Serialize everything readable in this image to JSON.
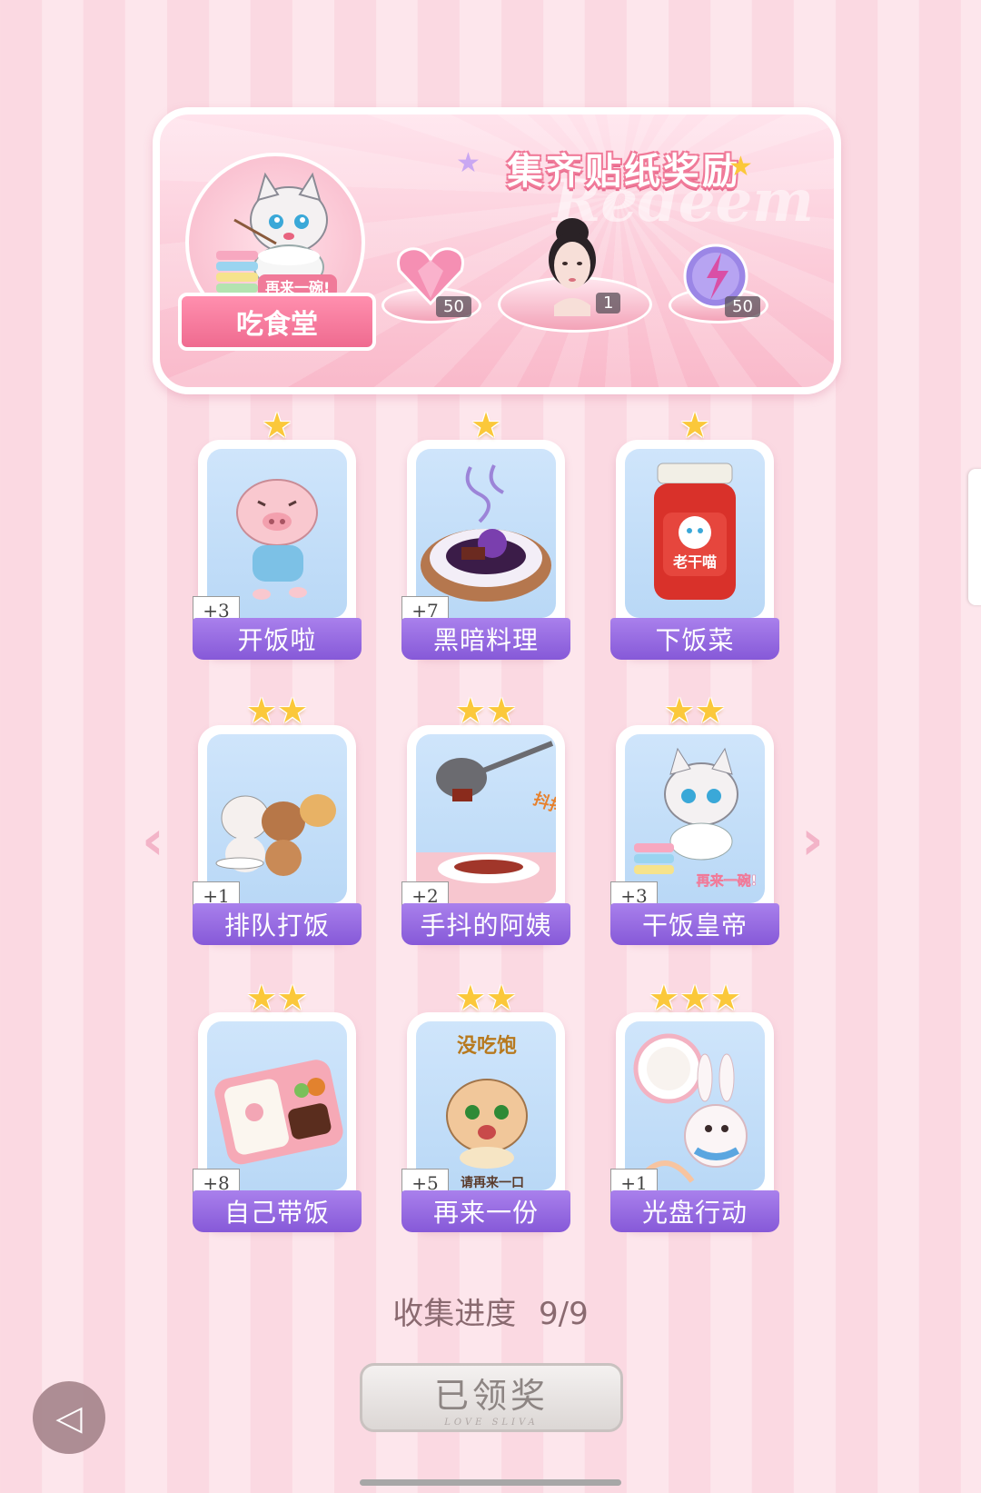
{
  "banner": {
    "title": "集齐贴纸奖励",
    "watermark": "Redeem",
    "sticker_set_name": "吃食堂",
    "sticker_set_caption": "再来一碗!",
    "rewards": [
      {
        "name": "pink-heart-gem",
        "count": "50"
      },
      {
        "name": "character-portrait",
        "count": "1"
      },
      {
        "name": "lightning-orb",
        "count": "50"
      }
    ]
  },
  "cards": [
    {
      "label": "开饭啦",
      "bonus": "+3",
      "stars": "★",
      "icon": "pig-running"
    },
    {
      "label": "黑暗料理",
      "bonus": "+7",
      "stars": "★",
      "icon": "dark-dish"
    },
    {
      "label": "下饭菜",
      "bonus": "",
      "stars": "★",
      "icon": "chili-jar",
      "jar_text": "老干喵"
    },
    {
      "label": "排队打饭",
      "bonus": "+1",
      "stars": "★★",
      "icon": "animals-queue"
    },
    {
      "label": "手抖的阿姨",
      "bonus": "+2",
      "stars": "★★",
      "icon": "ladle-shake",
      "img_text": "抖抖抖!"
    },
    {
      "label": "干饭皇帝",
      "bonus": "+3",
      "stars": "★★",
      "icon": "cat-eating",
      "img_text": "再来一碗!"
    },
    {
      "label": "自己带饭",
      "bonus": "+8",
      "stars": "★★",
      "icon": "bento-box"
    },
    {
      "label": "再来一份",
      "bonus": "+5",
      "stars": "★★",
      "icon": "hamster-hungry",
      "img_text_top": "没吃饱",
      "img_text_bottom": "请再来一口"
    },
    {
      "label": "光盘行动",
      "bonus": "+1",
      "stars": "★★★",
      "icon": "bunny-plate"
    }
  ],
  "nav": {
    "prev": "‹",
    "next": "›"
  },
  "progress": {
    "label": "收集进度",
    "value": "9/9"
  },
  "claim_button": {
    "label": "已领奖",
    "sub": "LOVE SLIVA"
  },
  "colors": {
    "accent": "#8659d8",
    "star": "#fbc83a",
    "pink": "#f07a99"
  }
}
